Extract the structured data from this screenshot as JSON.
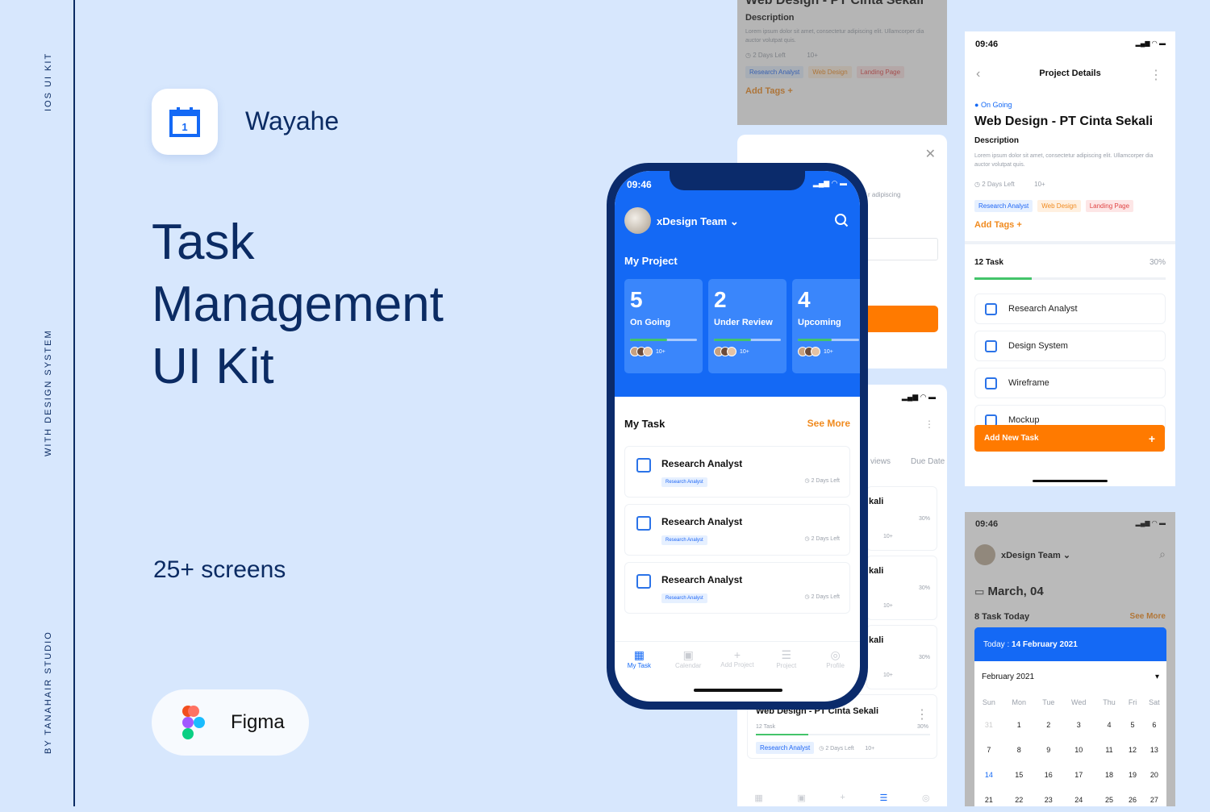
{
  "side_labels": {
    "top": "IOS UI KIT",
    "middle": "WITH DESIGN SYSTEM",
    "bottom": "BY TANAHAIR STUDIO"
  },
  "brand": {
    "name": "Wayahe",
    "icon": "calendar-icon",
    "icon_day": "1"
  },
  "hero": {
    "line1": "Task",
    "line2": "Management",
    "line3": "UI Kit"
  },
  "screens_count": "25+ screens",
  "tool_badge": {
    "label": "Figma",
    "icon": "figma-logo-icon"
  },
  "colors": {
    "background": "#d7e7fd",
    "navy": "#0b2b63",
    "primary": "#1469f5",
    "accent_orange": "#ff7a00",
    "progress_green": "#43c46a"
  },
  "main_phone": {
    "time": "09:46",
    "team": "xDesign Team",
    "section_title": "My Project",
    "projects": [
      {
        "count": "5",
        "label": "On Going",
        "progress": 0.55,
        "members": "10+"
      },
      {
        "count": "2",
        "label": "Under Review",
        "progress": 0.55,
        "members": "10+"
      },
      {
        "count": "4",
        "label": "Upcoming",
        "progress": 0.55,
        "members": "10+"
      }
    ],
    "tasks_title": "My Task",
    "see_more": "See More",
    "tasks": [
      {
        "title": "Research Analyst",
        "tag": "Research Analyst",
        "due": "2 Days Left"
      },
      {
        "title": "Research Analyst",
        "tag": "Research Analyst",
        "due": "2 Days Left"
      },
      {
        "title": "Research Analyst",
        "tag": "Research Analyst",
        "due": "2 Days Left"
      }
    ],
    "tabs": [
      {
        "label": "My Task",
        "icon": "grid-icon"
      },
      {
        "label": "Calendar",
        "icon": "calendar-icon"
      },
      {
        "label": "Add Project",
        "icon": "plus-icon"
      },
      {
        "label": "Project",
        "icon": "list-icon"
      },
      {
        "label": "Profile",
        "icon": "profile-icon"
      }
    ]
  },
  "top_mid_screen": {
    "title": "Web Design - PT Cinta Sekali",
    "desc_heading": "Description",
    "description": "Lorem ipsum dolor sit amet, consectetur adipiscing elit. Ullamcorper dia auctor volutpat quis.",
    "due": "2 Days Left",
    "members": "10+",
    "tags": [
      "Research Analyst",
      "Web Design",
      "Landing Page"
    ],
    "add_tags": "Add Tags"
  },
  "modal_screen": {
    "snippet": "r adipiscing"
  },
  "list_screen": {
    "tab_partial": "views",
    "tab_due": "Due Date",
    "rows": [
      {
        "title": "kali",
        "pct": "30%",
        "members": "10+"
      },
      {
        "title": "kali",
        "pct": "30%",
        "members": "10+"
      },
      {
        "title": "kali",
        "pct": "30%",
        "members": "10+"
      }
    ],
    "bottom_card": {
      "title": "Web Design - PT Cinta Sekali",
      "tasks": "12 Task",
      "pct": "30%",
      "tag": "Research Analyst",
      "due": "2 Days Left",
      "members": "10+"
    }
  },
  "details_screen": {
    "time": "09:46",
    "header": "Project Details",
    "status": "On Going",
    "title": "Web Design - PT Cinta Sekali",
    "desc_heading": "Description",
    "description": "Lorem ipsum dolor sit amet, consectetur adipiscing elit. Ullamcorper dia auctor volutpat quis.",
    "due": "2 Days Left",
    "members": "10+",
    "tags": [
      "Research Analyst",
      "Web Design",
      "Landing Page"
    ],
    "add_tags": "Add Tags",
    "task_count": "12 Task",
    "progress_label": "30%",
    "progress": 0.3,
    "tasks": [
      "Research Analyst",
      "Design System",
      "Wireframe",
      "Mockup"
    ],
    "add_button": "Add New Task"
  },
  "calendar_screen": {
    "time": "09:46",
    "team": "xDesign Team",
    "date": "March, 04",
    "tasks_today": "8 Task Today",
    "see_more": "See More",
    "today_label": "Today :",
    "today_value": "14 February 2021",
    "month": "February 2021",
    "weekdays": [
      "Sun",
      "Mon",
      "Tue",
      "Wed",
      "Thu",
      "Fri",
      "Sat"
    ],
    "weeks": [
      [
        "31",
        "1",
        "2",
        "3",
        "4",
        "5",
        "6"
      ],
      [
        "7",
        "8",
        "9",
        "10",
        "11",
        "12",
        "13"
      ],
      [
        "14",
        "15",
        "16",
        "17",
        "18",
        "19",
        "20"
      ],
      [
        "21",
        "22",
        "23",
        "24",
        "25",
        "26",
        "27"
      ]
    ]
  }
}
